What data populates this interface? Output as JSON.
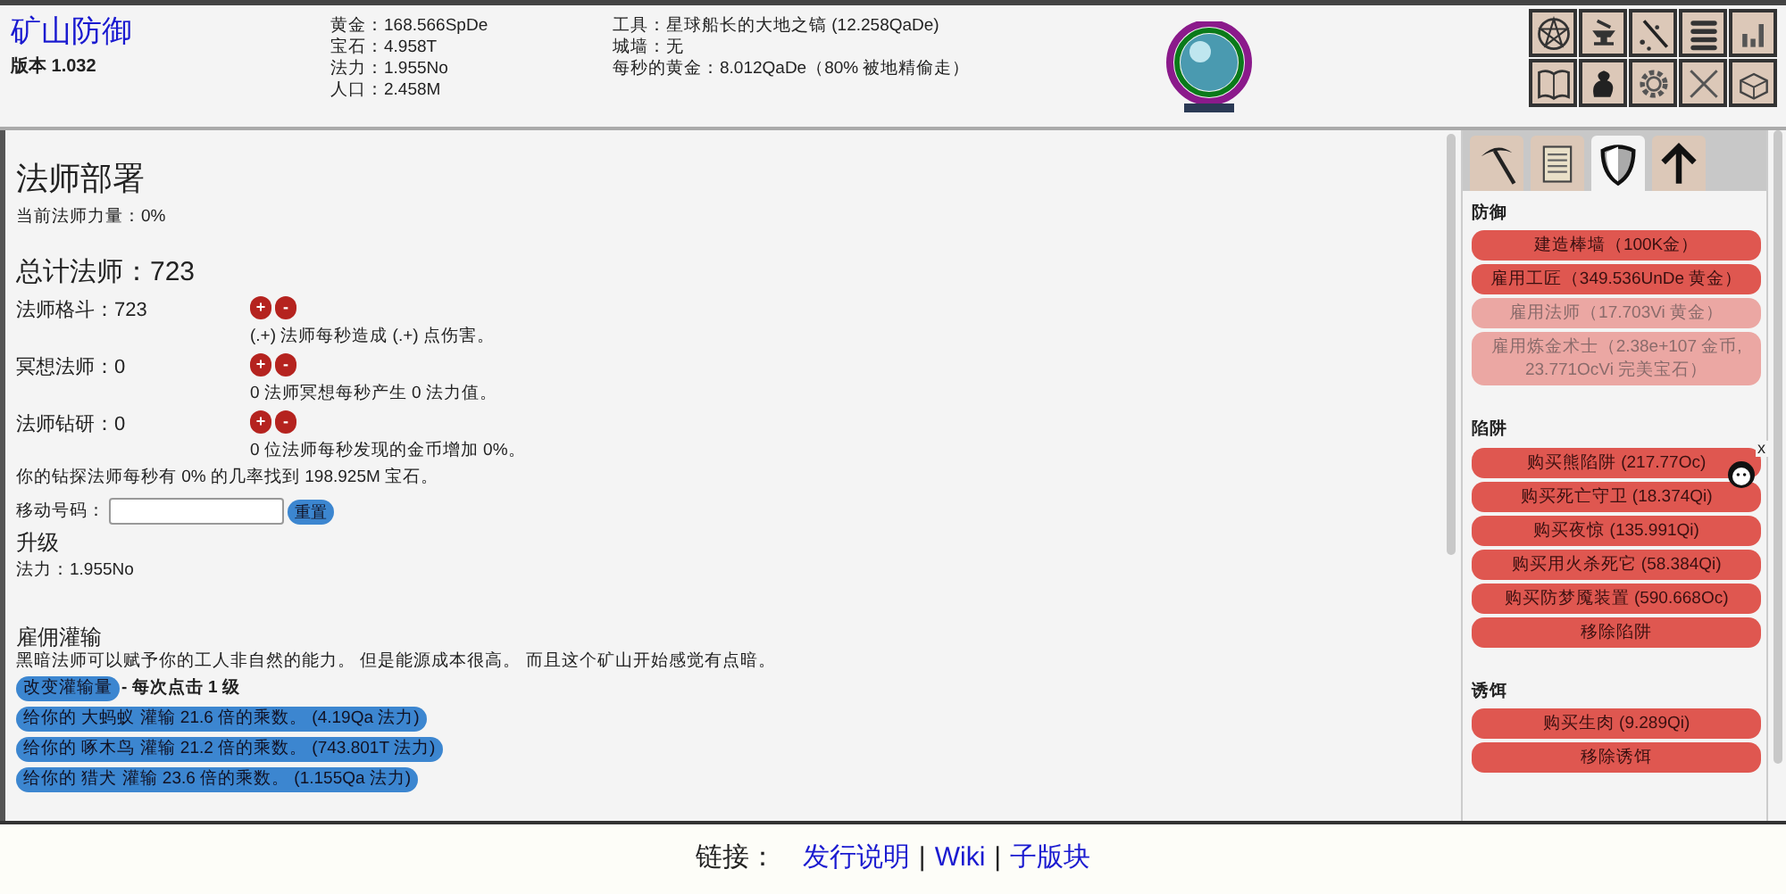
{
  "header": {
    "title": "矿山防御",
    "version": "版本 1.032",
    "stats_left": [
      "黄金：168.566SpDe",
      "宝石：4.958T",
      "法力：1.955No",
      "人口：2.458M"
    ],
    "stats_right": [
      "工具：星球船长的大地之镐 (12.258QaDe)",
      "城墙：无",
      "每秒的黄金：8.012QaDe（80% 被地精偷走）"
    ]
  },
  "main": {
    "title": "法师部署",
    "current_power": "当前法师力量：0%",
    "total": "总计法师：723",
    "assignments": [
      {
        "label": "法师格斗：723",
        "plus": "+",
        "minus": "-",
        "note": "(.+) 法师每秒造成 (.+) 点伤害。"
      },
      {
        "label": "冥想法师：0",
        "plus": "+",
        "minus": "-",
        "note": "0 法师冥想每秒产生 0 法力值。"
      },
      {
        "label": "法师钻研：0",
        "plus": "+",
        "minus": "-",
        "note": "0 位法师每秒发现的金币增加 0%。"
      }
    ],
    "drill_note": "你的钻探法师每秒有 0% 的几率找到 198.925M 宝石。",
    "move_label": "移动号码：",
    "reset_button": "重置",
    "upgrade_title": "升级",
    "mana": "法力：1.955No",
    "infusion": {
      "title": "雇佣灌输",
      "description": "黑暗法师可以赋予你的工人非自然的能力。 但是能源成本很高。 而且这个矿山开始感觉有点暗。",
      "change_button": "改变灌输量",
      "change_note": "- 每次点击 1 级",
      "items": [
        "给你的 大蚂蚁 灌输 21.6 倍的乘数。 (4.19Qa 法力)",
        "给你的 啄木鸟 灌输 21.2 倍的乘数。 (743.801T 法力)",
        "给你的 猎犬 灌输 23.6 倍的乘数。 (1.155Qa 法力)"
      ]
    }
  },
  "sidebar": {
    "tabs": [
      {
        "kind": "pickaxe",
        "selected": false
      },
      {
        "kind": "scroll",
        "selected": false
      },
      {
        "kind": "shield",
        "selected": true
      },
      {
        "kind": "arrow",
        "selected": false
      }
    ],
    "sections": [
      {
        "title": "防御",
        "buttons": [
          {
            "label": "建造棒墙（100K金）",
            "disabled": false
          },
          {
            "label": "雇用工匠（349.536UnDe 黄金）",
            "disabled": false
          },
          {
            "label": "雇用法师（17.703Vi 黄金）",
            "disabled": true
          },
          {
            "label": "雇用炼金术士（2.38e+107 金币, 23.771OcVi 完美宝石）",
            "disabled": true
          }
        ]
      },
      {
        "title": "陷阱",
        "buttons": [
          {
            "label": "购买熊陷阱 (217.77Oc)",
            "disabled": false
          },
          {
            "label": "购买死亡守卫 (18.374Qi)",
            "disabled": false
          },
          {
            "label": "购买夜惊 (135.991Qi)",
            "disabled": false
          },
          {
            "label": "购买用火杀死它 (58.384Qi)",
            "disabled": false
          },
          {
            "label": "购买防梦魇装置 (590.668Oc)",
            "disabled": false
          },
          {
            "label": "移除陷阱",
            "disabled": false
          }
        ]
      },
      {
        "title": "诱饵",
        "buttons": [
          {
            "label": "购买生肉 (9.289Qi)",
            "disabled": false
          },
          {
            "label": "移除诱饵",
            "disabled": false
          }
        ]
      }
    ]
  },
  "chat_close": "x",
  "footer": {
    "label": "链接：",
    "links": [
      "发行说明",
      "Wiki",
      "子版块"
    ],
    "separator": "|"
  }
}
